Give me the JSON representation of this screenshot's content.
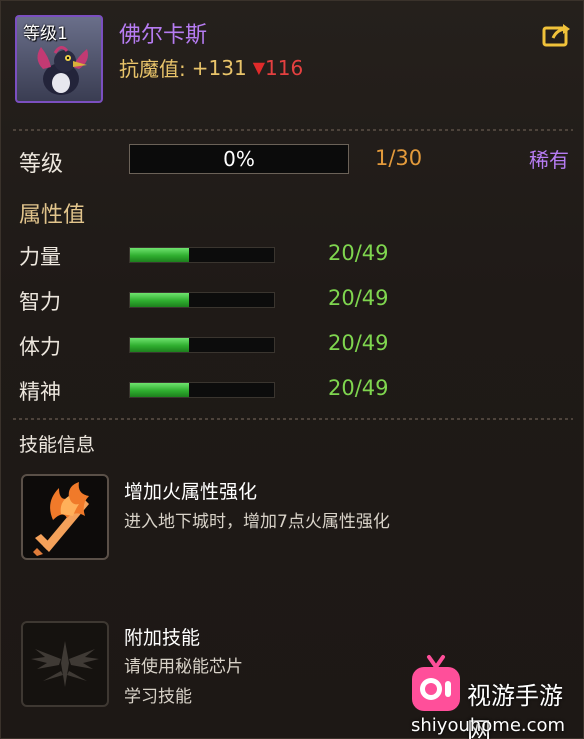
{
  "header": {
    "portrait_level": "等级1",
    "pet_name": "佛尔卡斯",
    "resist_label": "抗魔值:",
    "resist_plus": "+131",
    "resist_arrow": "▼",
    "resist_minus": "116",
    "share_icon": "share-icon"
  },
  "level": {
    "label": "等级",
    "percent_text": "0%",
    "progress_fraction": 0.0,
    "count": "1/30",
    "rarity": "稀有"
  },
  "attributes": {
    "title": "属性值",
    "items": [
      {
        "name": "力量",
        "value": "20/49",
        "fraction": 0.408
      },
      {
        "name": "智力",
        "value": "20/49",
        "fraction": 0.408
      },
      {
        "name": "体力",
        "value": "20/49",
        "fraction": 0.408
      },
      {
        "name": "精神",
        "value": "20/49",
        "fraction": 0.408
      }
    ]
  },
  "skills": {
    "title": "技能信息",
    "main": {
      "name": "增加火属性强化",
      "desc": "进入地下城时，增加7点火属性强化",
      "icon": "fire-sword-icon"
    },
    "extra": {
      "name": "附加技能",
      "desc_line1": "请使用秘能芯片",
      "desc_line2": "学习技能",
      "icon": "wing-emblem-icon"
    }
  },
  "watermark": {
    "title": "视游手游网",
    "url": "shiyouhome.com",
    "icon": "tv-logo-icon"
  },
  "colors": {
    "name_purple": "#b67cf2",
    "resist_yellow": "#e9c46a",
    "resist_red": "#e54040",
    "level_orange": "#e39a3b",
    "stat_green": "#7fd64f",
    "border_purple": "#7b4fc0"
  }
}
